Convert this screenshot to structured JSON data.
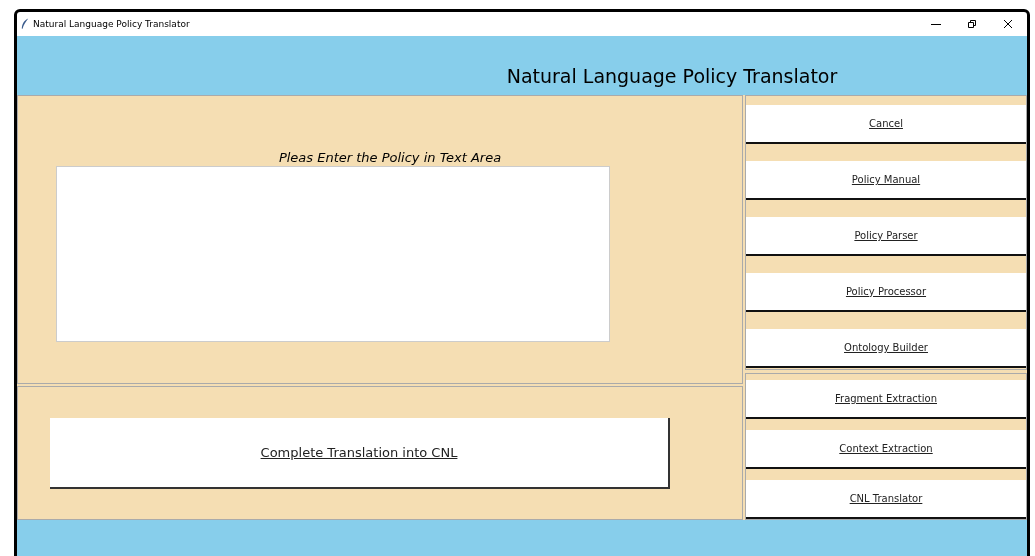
{
  "window": {
    "title": "Natural Language Policy Translator"
  },
  "header": {
    "title": "Natural Language Policy Translator"
  },
  "input_panel": {
    "label": "Pleas Enter the Policy in Text Area"
  },
  "action_button": {
    "label": "Complete Translation into CNL"
  },
  "side_groups": [
    {
      "buttons": [
        "Cancel",
        "Policy Manual",
        "Policy Parser",
        "Policy Processor",
        "Ontology Builder"
      ]
    },
    {
      "buttons": [
        "Fragment Extraction",
        "Context Extraction",
        "CNL Translator"
      ]
    }
  ]
}
